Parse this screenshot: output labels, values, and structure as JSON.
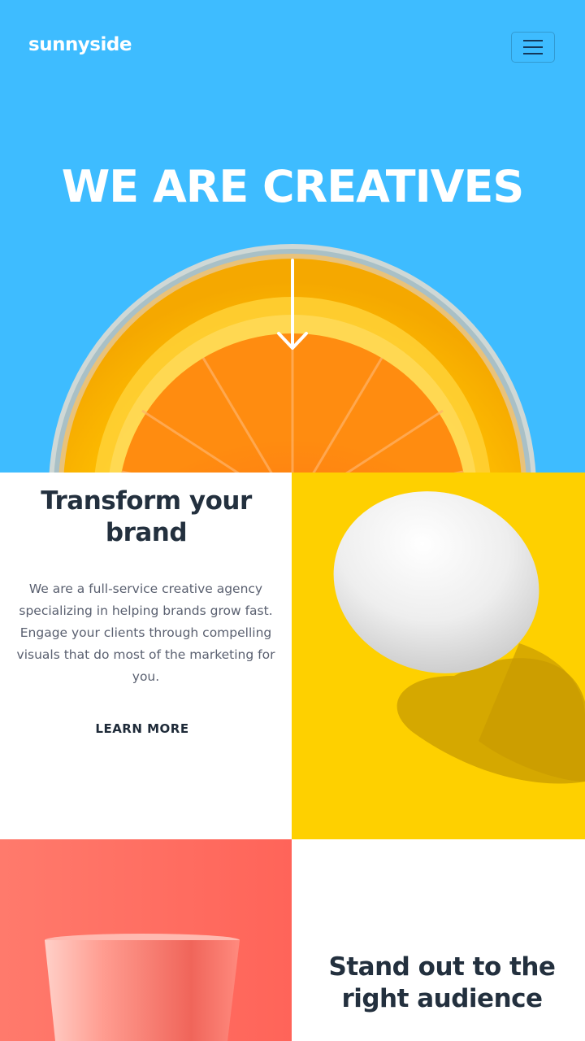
{
  "header": {
    "logo": "sunnyside",
    "menu_icon": "hamburger-icon"
  },
  "hero": {
    "title": "WE ARE CREATIVES",
    "scroll_icon": "arrow-down-icon",
    "image": "orange-slice-in-glass"
  },
  "transform": {
    "title": "Transform your brand",
    "body": "We are a full-service creative agency specializing in helping brands grow fast. Engage your clients through compelling visuals that do most of the marketing for you.",
    "link_label": "LEARN MORE",
    "image": "egg-on-yellow"
  },
  "standout": {
    "title": "Stand out to the right audience",
    "image": "pink-cup"
  },
  "colors": {
    "hero_bg": "#3ebcff",
    "egg_bg": "#fed000",
    "cup_bg": "#ff6e63",
    "heading": "#23303e",
    "body_text": "#5a6070"
  }
}
